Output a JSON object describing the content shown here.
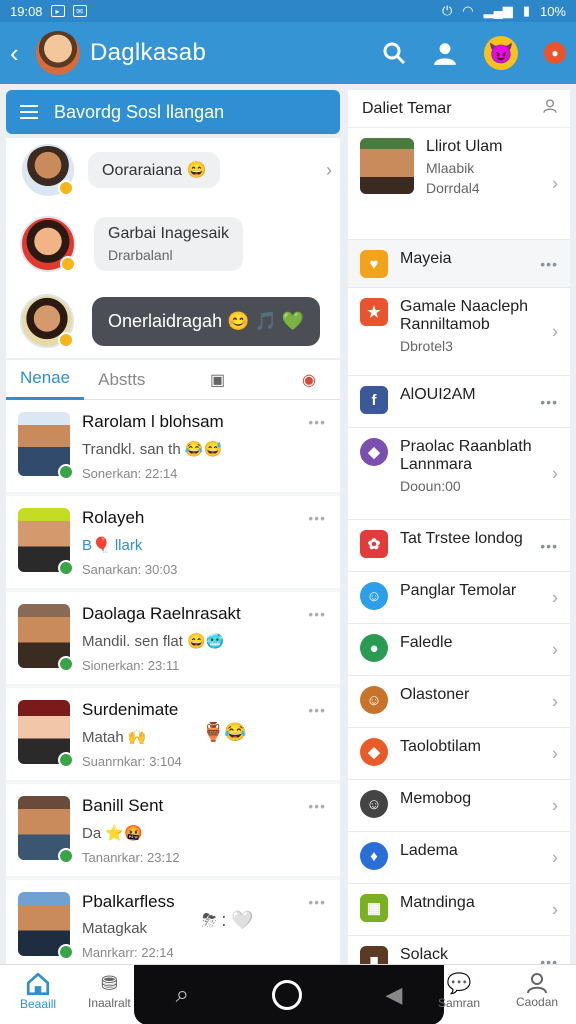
{
  "status": {
    "time": "19:08",
    "battery": "10%"
  },
  "app": {
    "title": "Daglkasab"
  },
  "left_header": {
    "title": "Bavordg Sosl llangan"
  },
  "stories": [
    {
      "text": "Ooraraiana",
      "emoji": "😄"
    },
    {
      "text": "Garbai Inagesaik",
      "sub": "Drarbalanl"
    },
    {
      "text": "Onerlaidragah",
      "emoji": "😊 🎵 💚"
    }
  ],
  "tabs": [
    {
      "label": "Nenae"
    },
    {
      "label": "Abstts"
    }
  ],
  "chats": [
    {
      "name": "Rarolam l blohsam",
      "msg": "Trandkl. san th",
      "emoji": "😂😅",
      "time": "Sonerkan: 22:14",
      "colors": [
        "#dbe7f3",
        "#304b6b"
      ]
    },
    {
      "name": "Rolayeh",
      "msg": "B🎈 llark",
      "emoji": "",
      "time": "Sanarkan: 30:03",
      "colors": [
        "#c4dc24",
        "#2a2a2a"
      ]
    },
    {
      "name": "Daolaga Raelnrasakt",
      "msg": "Mandil. sen flat",
      "emoji": "😄🥶",
      "time": "Sionerkan: 23:11",
      "colors": [
        "#c9b8a8",
        "#3b2c22"
      ]
    },
    {
      "name": "Surdenimate",
      "msg": "Matah 🙌",
      "emoji": "🏺😂",
      "time": "Suanrnkar: 3:104",
      "colors": [
        "#f2c6a8",
        "#5a2a1a"
      ]
    },
    {
      "name": "Banill Sent",
      "msg": "Da ⭐🤬",
      "emoji": "",
      "time": "Tananrkar: 23:12",
      "colors": [
        "#c98a5c",
        "#3a5670"
      ]
    },
    {
      "name": "Pbalkarfless",
      "msg": "Matagkak",
      "emoji": "⛈ : 🤍",
      "time": "Manrkarr: 22:14",
      "colors": [
        "#6fa2d0",
        "#1e2d3f"
      ]
    }
  ],
  "right_header": {
    "title": "Daliet Temar"
  },
  "right_items": [
    {
      "title": "Llirot Ulam",
      "sub1": "Mlaabik",
      "sub2": "Dorrdal4",
      "kind": "photo",
      "color": "#4b7a3e",
      "end": "chevron"
    },
    {
      "title": "Mayeia",
      "kind": "icon",
      "color": "#f2a31b",
      "glyph": "♥",
      "end": "dots",
      "highlight": true
    },
    {
      "title": "Gamale Naacleph",
      "sub1": "Ranniltamob",
      "sub2": "Dbrotel3",
      "kind": "icon",
      "color": "#e8542e",
      "glyph": "★",
      "end": "chevron"
    },
    {
      "title": "AlOUI2AM",
      "kind": "icon",
      "color": "#3b5998",
      "glyph": "f",
      "end": "dots"
    },
    {
      "title": "Praolac Raanblath",
      "sub1": "Lannmara",
      "sub2": "Dooun:00",
      "kind": "icon",
      "color": "#7b4fb0",
      "glyph": "◆",
      "end": "chevron"
    },
    {
      "title": "Tat Trstee londog",
      "kind": "icon",
      "color": "#e23b3b",
      "glyph": "✿",
      "end": "dots"
    },
    {
      "title": "Panglar Temolar",
      "kind": "icon",
      "color": "#2d9ee8",
      "glyph": "☺",
      "end": "chevron"
    },
    {
      "title": "Faledle",
      "kind": "icon",
      "color": "#2b9a52",
      "glyph": "●",
      "end": "chevron"
    },
    {
      "title": "Olastoner",
      "kind": "icon",
      "color": "#c8732a",
      "glyph": "☺",
      "end": "chevron"
    },
    {
      "title": "Taolobtilam",
      "kind": "icon",
      "color": "#e95c2a",
      "glyph": "◆",
      "end": "chevron"
    },
    {
      "title": "Memobog",
      "kind": "icon",
      "color": "#444444",
      "glyph": "☺",
      "end": "chevron"
    },
    {
      "title": "Ladema",
      "kind": "icon",
      "color": "#2a6fd6",
      "glyph": "♦",
      "end": "chevron"
    },
    {
      "title": "Matndinga",
      "kind": "icon",
      "color": "#7ab022",
      "glyph": "▦",
      "end": "chevron"
    },
    {
      "title": "Solack",
      "kind": "icon",
      "color": "#5a3a22",
      "glyph": "■",
      "end": "dots"
    }
  ],
  "bottom_nav": [
    {
      "label": "Beaaill"
    },
    {
      "label": "Inaalralt"
    },
    {
      "label": "Samran"
    },
    {
      "label": "Caodan"
    }
  ],
  "colors": {
    "primary": "#3594d4",
    "header": "#2f8fd2",
    "online": "#3aa548"
  }
}
